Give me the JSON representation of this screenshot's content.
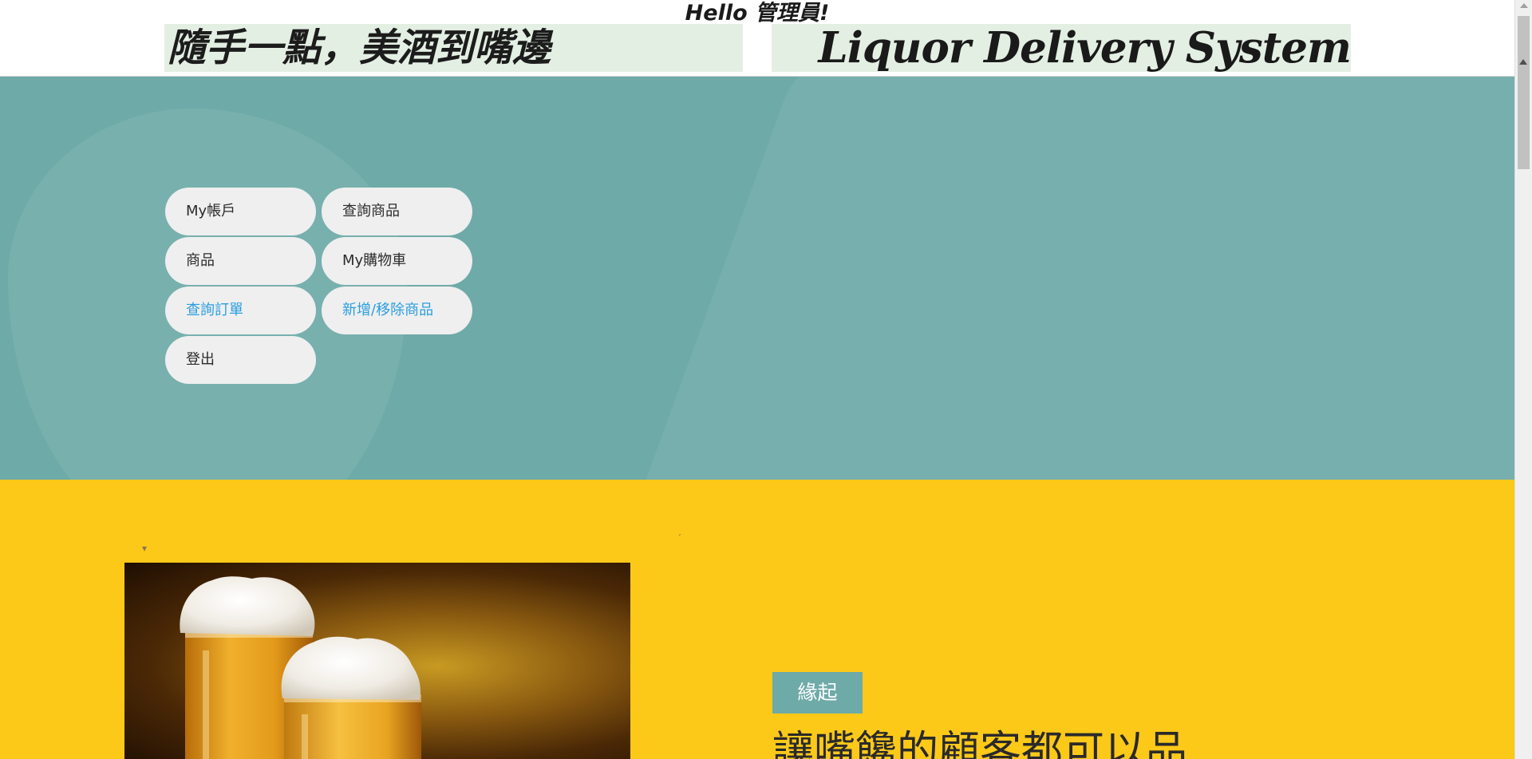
{
  "header": {
    "greeting": "Hello 管理員!",
    "slogan": "隨手一點，美酒到嘴邊",
    "brand": "Liquor Delivery System"
  },
  "nav": {
    "items": [
      {
        "label": "My帳戶",
        "style": "default"
      },
      {
        "label": "查詢商品",
        "style": "default"
      },
      {
        "label": "商品",
        "style": "default"
      },
      {
        "label": "My購物車",
        "style": "default"
      },
      {
        "label": "查詢訂單",
        "style": "link"
      },
      {
        "label": "新增/移除商品",
        "style": "link"
      },
      {
        "label": "登出",
        "style": "default"
      }
    ]
  },
  "about": {
    "tag": "緣起",
    "heading": "讓嘴饞的顧客都可以品"
  },
  "colors": {
    "hero_bg": "#6eaaa8",
    "about_bg": "#fdc919",
    "nav_button_bg": "#efefef",
    "link_text": "#2a9ee0",
    "banner_bg": "#e4efe4"
  },
  "icons": {
    "beer_image": "beer-glasses-photo"
  }
}
